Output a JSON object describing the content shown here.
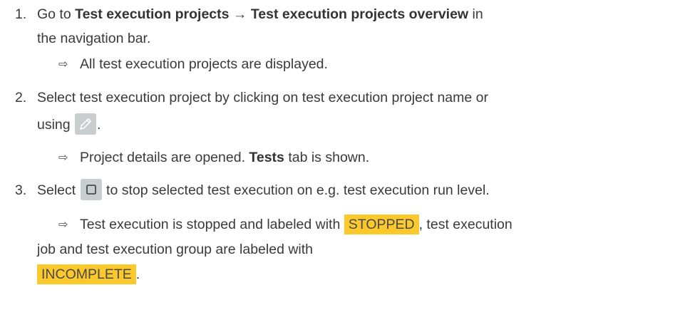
{
  "steps": [
    {
      "number": "1.",
      "line1": {
        "pre": "Go to ",
        "bold1": "Test execution projects",
        "arrow": " → ",
        "bold2": "Test execution projects overview",
        "post": " in"
      },
      "line2": "the navigation bar.",
      "result": "All test execution projects are displayed."
    },
    {
      "number": "2.",
      "line1": "Select test execution project by clicking on test execution project name or",
      "line2_pre": "using",
      "line2_post": ".",
      "icon": "pencil-edit-icon",
      "result_pre": "Project details are opened. ",
      "result_bold": "Tests",
      "result_post": " tab is shown."
    },
    {
      "number": "3.",
      "line1_pre": "Select",
      "line1_post": "to stop selected test execution on e.g. test execution run level.",
      "icon": "stop-square-icon",
      "result_line1_pre": "Test execution is stopped and labeled with",
      "badge_stopped": "STOPPED",
      "result_line1_post": ", test execution",
      "result_line2": "job and test execution group are labeled with",
      "badge_incomplete": "INCOMPLETE",
      "result_line3_post": "."
    }
  ],
  "result_arrow_glyph": "⇨",
  "colors": {
    "badge": "#fcc92c",
    "icon_bg": "#c8cdd0",
    "text": "#3a3a3a"
  }
}
